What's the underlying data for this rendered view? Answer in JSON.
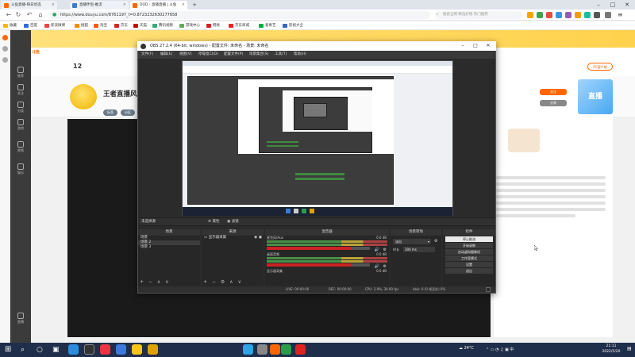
{
  "browser": {
    "tabs": [
      {
        "label": "斗鱼直播-每日优选",
        "active": false
      },
      {
        "label": "直播伴侣-推流",
        "active": false
      },
      {
        "label": "DOD - 直播直播 | 斗鱼",
        "active": true
      }
    ],
    "url": "https://www.douyu.com/8761197_t=0.8723232630277658",
    "search_placeholder": "搜索全网 精选好物 热门推荐",
    "bookmarks": [
      "收藏",
      "百度",
      "新浪微博",
      "搜狐",
      "淘宝",
      "京东",
      "天猫",
      "腾讯视频",
      "游戏中心",
      "网易",
      "京东商城",
      "爱奇艺",
      "影视大全"
    ],
    "accent": "#ff6600"
  },
  "site": {
    "room_title": "王者直播风女",
    "room_tags": [
      "标签",
      "分区"
    ],
    "stats_number": "12",
    "side_items": [
      "推荐",
      "关注",
      "分类",
      "游戏",
      "视频",
      "娱乐",
      "直播"
    ],
    "rp_button_follow": "关注",
    "rp_button_share": "分享",
    "rp_badge": "PC客户端",
    "rp_image_text": "直播"
  },
  "obs": {
    "title": "OBS 27.2.4 (64-bit, windows) - 配置文件: 未命名 - 场景: 未命名",
    "menu": [
      "文件(F)",
      "编辑(E)",
      "视图(V)",
      "停靠窗口(D)",
      "配置文件(P)",
      "场景集合(S)",
      "工具(T)",
      "帮助(H)"
    ],
    "scene_bar_title": "未选择源",
    "scene_bar_buttons": [
      "属性",
      "滤镜"
    ],
    "docks": {
      "scenes": {
        "title": "场景",
        "items": [
          "场景",
          "场景 2",
          "场景 3"
        ]
      },
      "sources": {
        "title": "来源",
        "items": [
          "显示器采集"
        ]
      },
      "mixer": {
        "title": "混音器",
        "channels": [
          {
            "name": "麦克风/Aux",
            "db": "0.0 dB"
          },
          {
            "name": "桌面音频",
            "db": "0.0 dB"
          },
          {
            "name": "显示器采集",
            "db": "0.0 dB"
          }
        ]
      },
      "transitions": {
        "title": "场景转场",
        "type": "淡出",
        "duration_label": "时长",
        "duration_value": "300 ms"
      },
      "controls": {
        "title": "控件",
        "buttons": [
          "停止推流",
          "开始录制",
          "启动虚拟摄像机",
          "工作室模式",
          "设置",
          "退出"
        ]
      }
    },
    "status": {
      "live": "LIVE: 00:00:00",
      "rec": "REC: 00:00:00",
      "cpu": "CPU: 2.9%, 30.00 fps",
      "kb": "kb/s: 0 (0 帧丢失) 0%"
    }
  },
  "taskbar": {
    "weather": "24°C",
    "time": "21:11",
    "date": "2022/5/20"
  }
}
